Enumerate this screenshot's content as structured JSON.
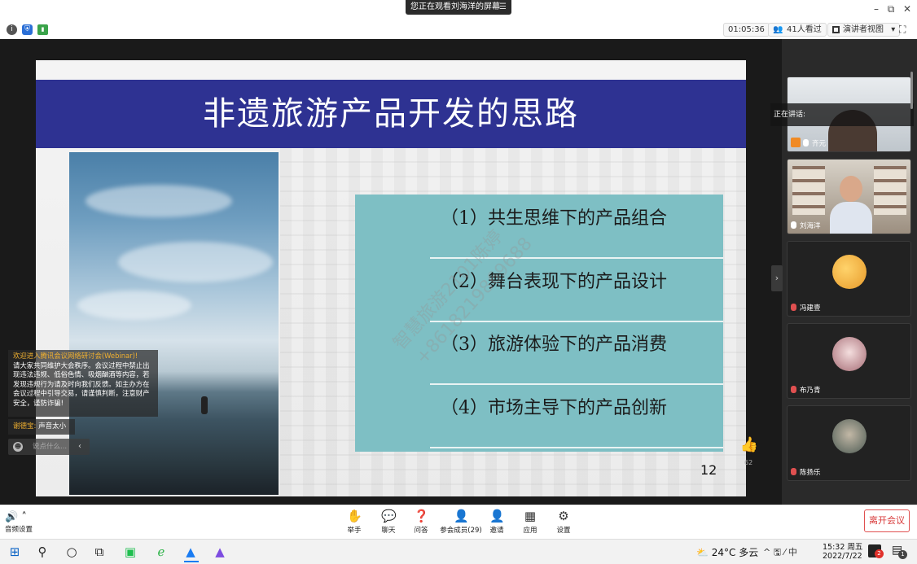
{
  "titlebar": {
    "share_banner": "您正在观看刘海洋的屏幕",
    "banner_menu_icon": "menu-icon",
    "minimize": "–",
    "restore": "⧉",
    "close": "✕"
  },
  "toolbar": {
    "timer": "01:05:36",
    "viewers": "41人看过",
    "view_mode": "演讲者视图",
    "view_mode_arrow": "▾",
    "fullscreen": "⛶",
    "info": "i",
    "shield": "⛨",
    "signal": "▮"
  },
  "slide": {
    "title": "非遗旅游产品开发的思路",
    "items": [
      "（1）共生思维下的产品组合",
      "（2）舞台表现下的产品设计",
      "（3）旅游体验下的产品消费",
      "（4）市场主导下的产品创新"
    ],
    "page_number": "12",
    "watermark_1": "智慧旅游2101陈婷",
    "watermark_2": "+8618219869688"
  },
  "chat": {
    "welcome_title": "欢迎进入腾讯会议网络研讨会(Webinar)!",
    "welcome_body": "请大家共同维护大会秩序。会议过程中禁止出现违法违规、低俗色情、吸烟酗酒等内容，若发现违规行为请及时向我们反馈。如主办方在会议过程中引导交易，请谨慎判断，注意财产安全，谨防诈骗!",
    "last_msg_user": "谢德宝:",
    "last_msg_text": "声音太小",
    "input_placeholder": "说点什么...",
    "collapse": "‹"
  },
  "like": {
    "icon": "thumbs-up-icon",
    "glyph": "👍",
    "count": "62"
  },
  "side": {
    "speaking_label": "正在讲话:",
    "collapse": "›",
    "tiles": [
      {
        "name": "齐元"
      },
      {
        "name": "刘海洋"
      },
      {
        "name": "冯建壹"
      },
      {
        "name": "布乃青"
      },
      {
        "name": "陈扬乐"
      }
    ]
  },
  "bottombar": {
    "audio_settings": "音频设置",
    "raise_hand": "举手",
    "chat": "聊天",
    "qa": "问答",
    "participants": "参会成员(29)",
    "invite": "邀请",
    "apps": "应用",
    "settings": "设置",
    "leave": "离开会议"
  },
  "taskbar": {
    "weather": "24°C 多云",
    "tray": "^ 🖫 ⁄ 中",
    "time": "15:32 周五",
    "date": "2022/7/22",
    "notif_count": "2",
    "notif_count2": "1"
  }
}
